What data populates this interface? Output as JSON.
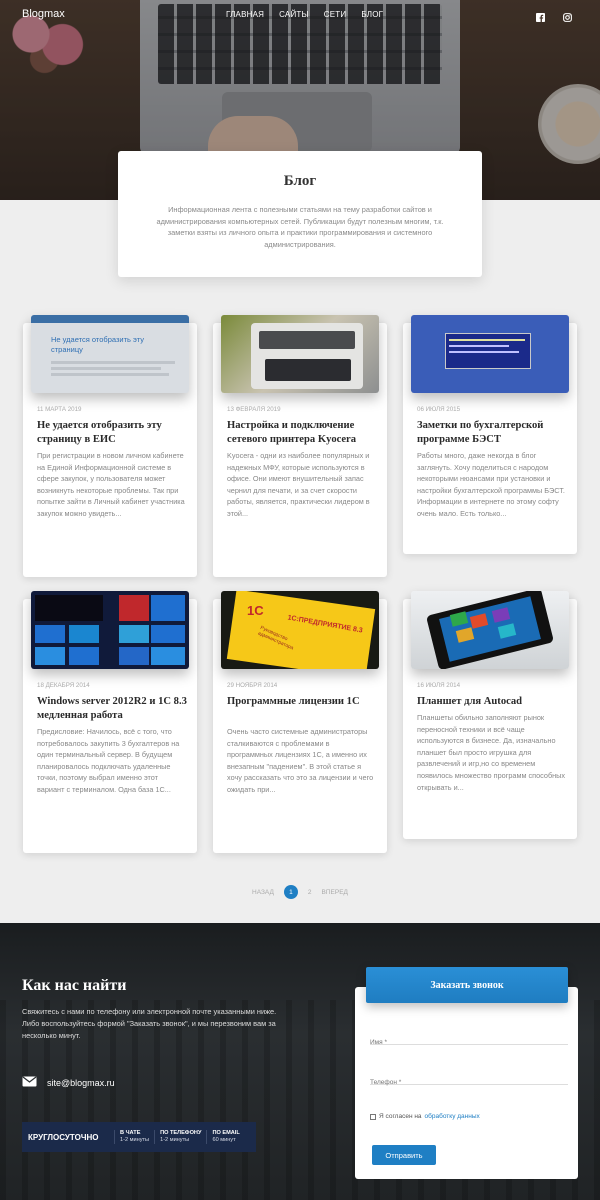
{
  "header": {
    "brand": "Blogmax",
    "nav": [
      "ГЛАВНАЯ",
      "САЙТЫ",
      "СЕТИ",
      "БЛОГ"
    ],
    "social_icons": [
      "facebook-icon",
      "instagram-icon"
    ]
  },
  "intro": {
    "title": "Блог",
    "text": "Информационная лента с полезными статьями на тему разработки сайтов и администрирования компьютерных сетей. Публикации будут полезным многим, т.к. заметки взяты из личного опыта и практики программирования и системного администрирования."
  },
  "posts": [
    {
      "date": "11 МАРТА 2019",
      "title": "Не удается отобразить эту страницу в ЕИС",
      "excerpt": "При регистрации в новом личном кабинете на Единой Информационной системе в сфере закупок, у пользователя может возникнуть некоторые проблемы. Так при попытке зайти в Личный кабинет участника закупок можно увидеть...",
      "thumb": {
        "heading": "Не удается отобразить эту страницу"
      }
    },
    {
      "date": "13 ФЕВРАЛЯ 2019",
      "title": "Настройка и подключение сетевого принтера Kyocera",
      "excerpt": "Kyocera - одни из наиболее популярных и надежных МФУ, которые используются в офисе. Они имеют внушительный запас чернил для печати, и за счет скорости работы, является, практически лидером в этой..."
    },
    {
      "date": "06 ИЮЛЯ 2015",
      "title": "Заметки по бухгалтерской программе БЭСТ",
      "excerpt": "Работы много, даже некогда в блог заглянуть. Хочу поделиться с народом некоторыми нюансами при установки и настройки бухгалтерской программы БЭСТ. Информации в интернете по этому софту очень мало. Есть только..."
    },
    {
      "date": "18 ДЕКАБРЯ 2014",
      "title": "Windows server 2012R2 и 1С 8.3 медленная работа",
      "excerpt": "Предисловие: Начилось, всё с того, что потребовалось закупить 3 бухгалтеров на один терминальный сервер. В будущем планировалось подключать удаленные точки, поэтому выбрал именно этот вариант с терминалом. Одна база 1С..."
    },
    {
      "date": "29 НОЯБРЯ 2014",
      "title": "Программные лицензии 1С",
      "excerpt": "Очень часто системные администраторы сталкиваются с проблемами в программных лицензиях 1С, а именно их внезапным \"падением\". В этой статье я хочу рассказать что это за лицензии и чего ожидать при...",
      "thumb": {
        "brand": "1С",
        "label": "1С:ПРЕДПРИЯТИЕ 8.3",
        "sub": "Руководство администратора"
      }
    },
    {
      "date": "16 ИЮЛЯ 2014",
      "title": "Планшет для Autocad",
      "excerpt": "Планшеты обильно заполняют рынок переносной техники и всё чаще используются в бизнесе. Да, изначально планшет был просто игрушка для развлечений и игр,но со временем появилось множество программ способных открывать и..."
    }
  ],
  "pagination": {
    "prev": "НАЗАД",
    "pages": [
      "1",
      "2"
    ],
    "current": "1",
    "next": "ВПЕРЕД"
  },
  "footer": {
    "title": "Как нас найти",
    "lead": "Свяжитесь с нами по телефону или электронной почте указанными ниже. Либо воспользуйтесь формой \"Заказать звонок\", и мы перезвоним вам за несколько минут.",
    "email": "site@blogmax.ru",
    "banner": {
      "main": "КРУГЛОСУТОЧНО",
      "items": [
        {
          "title": "В ЧАТЕ",
          "sub": "1-2 минуты"
        },
        {
          "title": "ПО ТЕЛЕФОНУ",
          "sub": "1-2 минуты"
        },
        {
          "title": "ПО EMAIL",
          "sub": "60 минут"
        }
      ]
    }
  },
  "callback_form": {
    "title": "Заказать звонок",
    "name_placeholder": "Имя *",
    "phone_placeholder": "Телефон *",
    "consent_text": "Я согласен на",
    "consent_link": "обработку данных",
    "submit_label": "Отправить"
  },
  "colors": {
    "accent": "#1f7fc4",
    "footer_bg": "#1f2224"
  }
}
